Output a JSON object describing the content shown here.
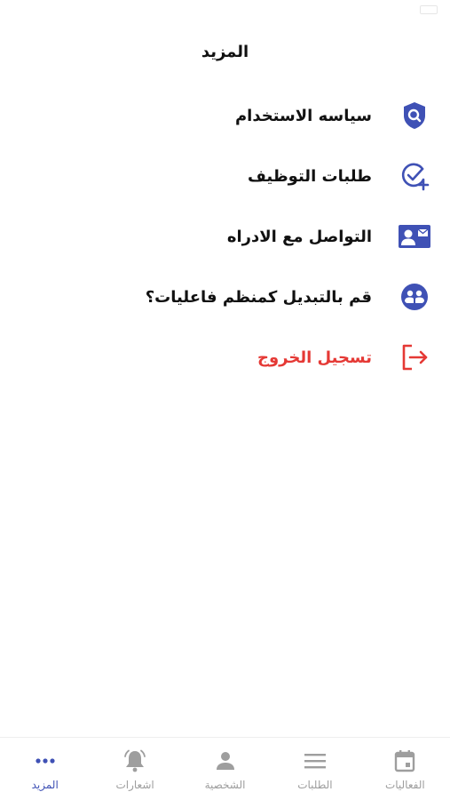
{
  "header": {
    "title": "المزيد"
  },
  "menu": [
    {
      "label": "سياسه الاستخدام",
      "icon": "shield-search-icon"
    },
    {
      "label": "طلبات التوظيف",
      "icon": "check-plus-icon"
    },
    {
      "label": "التواصل مع الادراه",
      "icon": "contact-card-icon"
    },
    {
      "label": "قم بالتبديل كمنظم فاعليات؟",
      "icon": "switch-organizer-icon"
    },
    {
      "label": "تسجيل الخروج",
      "icon": "logout-icon"
    }
  ],
  "tabs": [
    {
      "label": "المزيد",
      "icon": "more-dots-icon",
      "active": true
    },
    {
      "label": "اشعارات",
      "icon": "bell-icon",
      "active": false
    },
    {
      "label": "الشخصية",
      "icon": "person-icon",
      "active": false
    },
    {
      "label": "الطلبات",
      "icon": "list-icon",
      "active": false
    },
    {
      "label": "الفعاليات",
      "icon": "calendar-icon",
      "active": false
    }
  ],
  "colors": {
    "accent": "#3f51b5",
    "danger": "#e53935",
    "inactive": "#9e9e9e"
  }
}
